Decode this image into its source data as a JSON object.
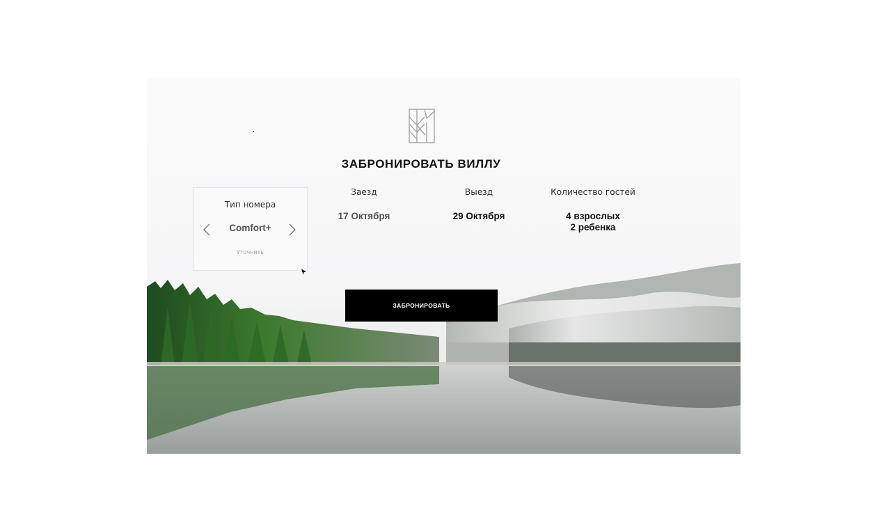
{
  "booking": {
    "title": "ЗАБРОНИРОВАТЬ ВИЛЛУ",
    "room_type": {
      "label": "Тип номера",
      "value": "Comfort+",
      "refine": "Уточнить"
    },
    "check_in": {
      "label": "Заезд",
      "value": "17 Октября"
    },
    "check_out": {
      "label": "Выезд",
      "value": "29 Октября"
    },
    "guests": {
      "label": "Количество гостей",
      "adults": "4 взрослых",
      "children": "2 ребенка"
    },
    "book_button": "ЗАБРОНИРОВАТЬ"
  },
  "icons": {
    "logo": "villa-logo-icon",
    "prev": "chevron-left-icon",
    "next": "chevron-right-icon",
    "cursor": "mouse-cursor-icon"
  },
  "colors": {
    "button_bg": "#000000",
    "button_text": "#ffffff",
    "refine_link": "#b89a92",
    "logo_stroke": "#a9a9a9"
  }
}
